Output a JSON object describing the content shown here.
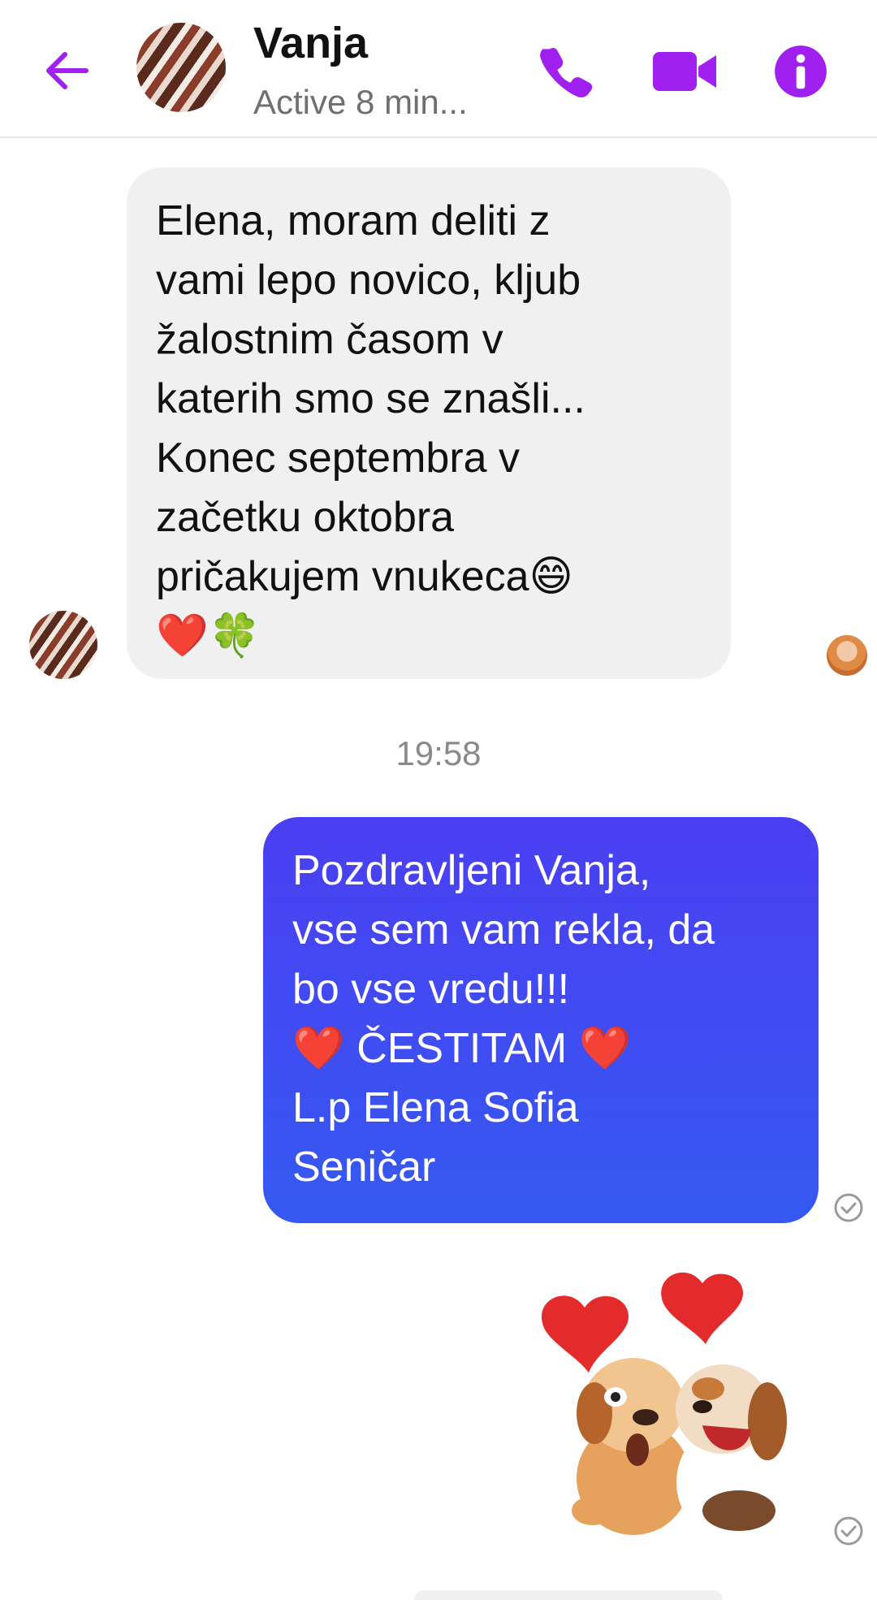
{
  "header": {
    "back_icon": "arrow-left-icon",
    "contact_name": "Vanja",
    "contact_status": "Active 8 min...",
    "call_icon": "phone-icon",
    "video_icon": "video-camera-icon",
    "info_icon": "info-icon",
    "accent": "#a020f0"
  },
  "messages": [
    {
      "direction": "incoming",
      "sender": "Vanja",
      "text": "Elena, moram deliti z\nvami lepo novico, kljub\nžalostnim časom v\nkaterih smo se znašli...\nKonec septembra v\nzačetku oktobra\npričakujem vnukeca😄\n❤️🍀",
      "bubble_color": "#f0f0f0"
    },
    {
      "direction": "timestamp",
      "text": "19:58"
    },
    {
      "direction": "outgoing",
      "text": "Pozdravljeni Vanja,\nvse sem vam rekla, da\nbo vse vredu!!!\n❤️ ČESTITAM ❤️\nL.p Elena Sofia\nSeničar",
      "bubble_color": "#3f4ef2",
      "status_icon": "sent-check-icon"
    },
    {
      "direction": "outgoing",
      "type": "sticker",
      "sticker": "hugging-puppies-hearts-sticker",
      "status_icon": "sent-check-icon"
    }
  ]
}
